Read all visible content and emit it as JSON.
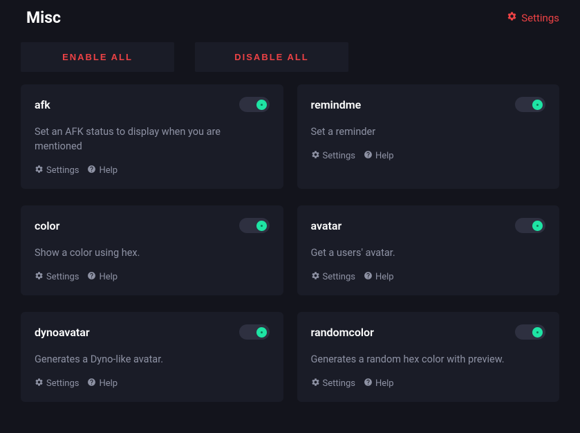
{
  "header": {
    "title": "Misc",
    "settingsLabel": "Settings"
  },
  "actions": {
    "enableAll": "ENABLE ALL",
    "disableAll": "DISABLE ALL"
  },
  "labels": {
    "settings": "Settings",
    "help": "Help"
  },
  "cards": [
    {
      "name": "afk",
      "desc": "Set an AFK status to display when you are mentioned",
      "enabled": true
    },
    {
      "name": "remindme",
      "desc": "Set a reminder",
      "enabled": true
    },
    {
      "name": "color",
      "desc": "Show a color using hex.",
      "enabled": true
    },
    {
      "name": "avatar",
      "desc": "Get a users' avatar.",
      "enabled": true
    },
    {
      "name": "dynoavatar",
      "desc": "Generates a Dyno-like avatar.",
      "enabled": true
    },
    {
      "name": "randomcolor",
      "desc": "Generates a random hex color with preview.",
      "enabled": true
    }
  ]
}
